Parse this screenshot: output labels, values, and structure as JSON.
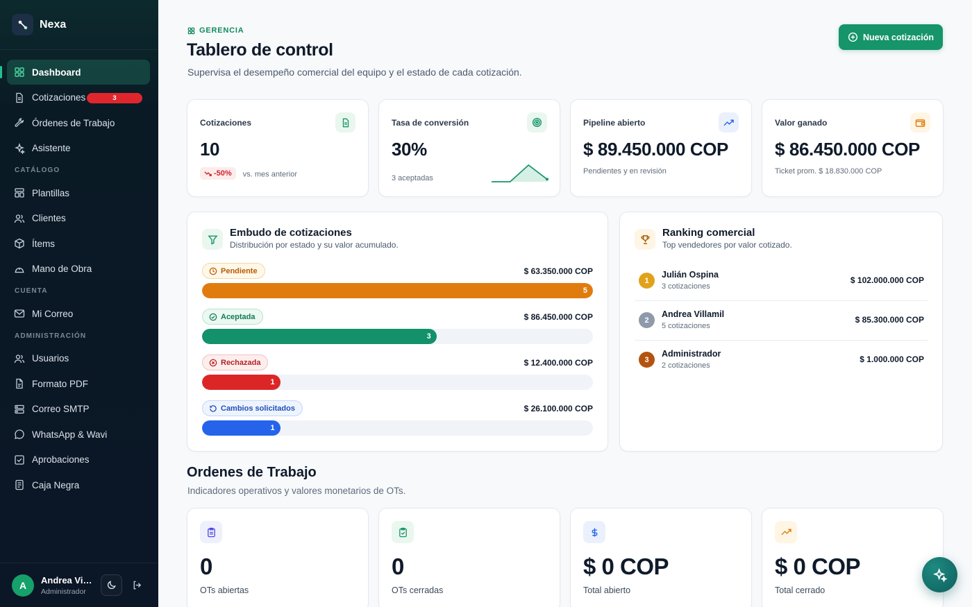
{
  "app": {
    "name": "Nexa"
  },
  "sidebar": {
    "items": [
      {
        "label": "Dashboard",
        "icon": "dashboard-icon",
        "active": true
      },
      {
        "label": "Cotizaciones",
        "icon": "document-icon",
        "badge": "3"
      },
      {
        "label": "Órdenes de Trabajo",
        "icon": "wrench-icon"
      },
      {
        "label": "Asistente",
        "icon": "sparkles-icon"
      }
    ],
    "sections": [
      {
        "title": "CATÁLOGO",
        "items": [
          {
            "label": "Plantillas",
            "icon": "template-icon"
          },
          {
            "label": "Clientes",
            "icon": "users-icon"
          },
          {
            "label": "Ítems",
            "icon": "box-icon"
          },
          {
            "label": "Mano de Obra",
            "icon": "helmet-icon"
          }
        ]
      },
      {
        "title": "CUENTA",
        "items": [
          {
            "label": "Mi Correo",
            "icon": "mail-icon"
          }
        ]
      },
      {
        "title": "ADMINISTRACIÓN",
        "items": [
          {
            "label": "Usuarios",
            "icon": "users-icon"
          },
          {
            "label": "Formato PDF",
            "icon": "pdf-icon"
          },
          {
            "label": "Correo SMTP",
            "icon": "server-icon"
          },
          {
            "label": "WhatsApp & Wavi",
            "icon": "chat-icon"
          },
          {
            "label": "Aprobaciones",
            "icon": "check-square-icon"
          },
          {
            "label": "Caja Negra",
            "icon": "log-icon"
          }
        ]
      }
    ],
    "user": {
      "initial": "A",
      "name": "Andrea Vill...",
      "role": "Administrador"
    }
  },
  "header": {
    "eyebrow": "GERENCIA",
    "title": "Tablero de control",
    "subtitle": "Supervisa el desempeño comercial del equipo y el estado de cada cotización.",
    "new_button": "Nueva cotización"
  },
  "kpis": {
    "cotizaciones": {
      "label": "Cotizaciones",
      "value": "10",
      "trend": "-50%",
      "trend_note": "vs. mes anterior"
    },
    "conversion": {
      "label": "Tasa de conversión",
      "value": "30%",
      "note": "3 aceptadas",
      "sparkline": [
        0,
        0,
        1,
        0.15
      ]
    },
    "pipeline": {
      "label": "Pipeline abierto",
      "value": "$ 89.450.000 COP",
      "note": "Pendientes y en revisión"
    },
    "ganado": {
      "label": "Valor ganado",
      "value": "$ 86.450.000 COP",
      "note": "Ticket prom. $ 18.830.000 COP"
    }
  },
  "funnel": {
    "title": "Embudo de cotizaciones",
    "subtitle": "Distribución por estado y su valor acumulado.",
    "stages": [
      {
        "label": "Pendiente",
        "amount": "$ 63.350.000 COP",
        "count": "5",
        "fraction": 1.0,
        "color": "#e07c0e",
        "pill_bg": "#fff7e8",
        "pill_border": "#f3d9a6",
        "pill_text": "#b65d06",
        "icon": "clock-icon"
      },
      {
        "label": "Aceptada",
        "amount": "$ 86.450.000 COP",
        "count": "3",
        "fraction": 0.6,
        "color": "#12916a",
        "pill_bg": "#ecf8f2",
        "pill_border": "#b8e4cd",
        "pill_text": "#137a55",
        "icon": "check-circle-icon"
      },
      {
        "label": "Rechazada",
        "amount": "$ 12.400.000 COP",
        "count": "1",
        "fraction": 0.2,
        "color": "#dc2626",
        "pill_bg": "#fdeeee",
        "pill_border": "#f2c2c2",
        "pill_text": "#b42323",
        "icon": "x-circle-icon"
      },
      {
        "label": "Cambios solicitados",
        "amount": "$ 26.100.000 COP",
        "count": "1",
        "fraction": 0.2,
        "color": "#2563eb",
        "pill_bg": "#eef4fe",
        "pill_border": "#c4d6f8",
        "pill_text": "#1f4fb8",
        "icon": "refresh-icon"
      }
    ]
  },
  "ranking": {
    "title": "Ranking comercial",
    "subtitle": "Top vendedores por valor cotizado.",
    "rows": [
      {
        "rank": "1",
        "name": "Julián Ospina",
        "count": "3 cotizaciones",
        "value": "$ 102.000.000 COP",
        "color": "#e0a21a"
      },
      {
        "rank": "2",
        "name": "Andrea Villamil",
        "count": "5 cotizaciones",
        "value": "$ 85.300.000 COP",
        "color": "#8e9aab"
      },
      {
        "rank": "3",
        "name": "Administrador",
        "count": "2 cotizaciones",
        "value": "$ 1.000.000 COP",
        "color": "#b4530f"
      }
    ]
  },
  "ordenes": {
    "title": "Ordenes de Trabajo",
    "subtitle": "Indicadores operativos y valores monetarios de OTs.",
    "cards": [
      {
        "value": "0",
        "label": "OTs abiertas",
        "icon": "clipboard-icon"
      },
      {
        "value": "0",
        "label": "OTs cerradas",
        "icon": "clipboard-check-icon"
      },
      {
        "value": "$ 0 COP",
        "label": "Total abierto",
        "icon": "dollar-icon"
      },
      {
        "value": "$ 0 COP",
        "label": "Total cerrado",
        "icon": "trend-up-icon"
      }
    ]
  },
  "colors": {
    "accent": "#16946a",
    "sidebar_bg": "#0b1626",
    "danger": "#e0262d"
  }
}
